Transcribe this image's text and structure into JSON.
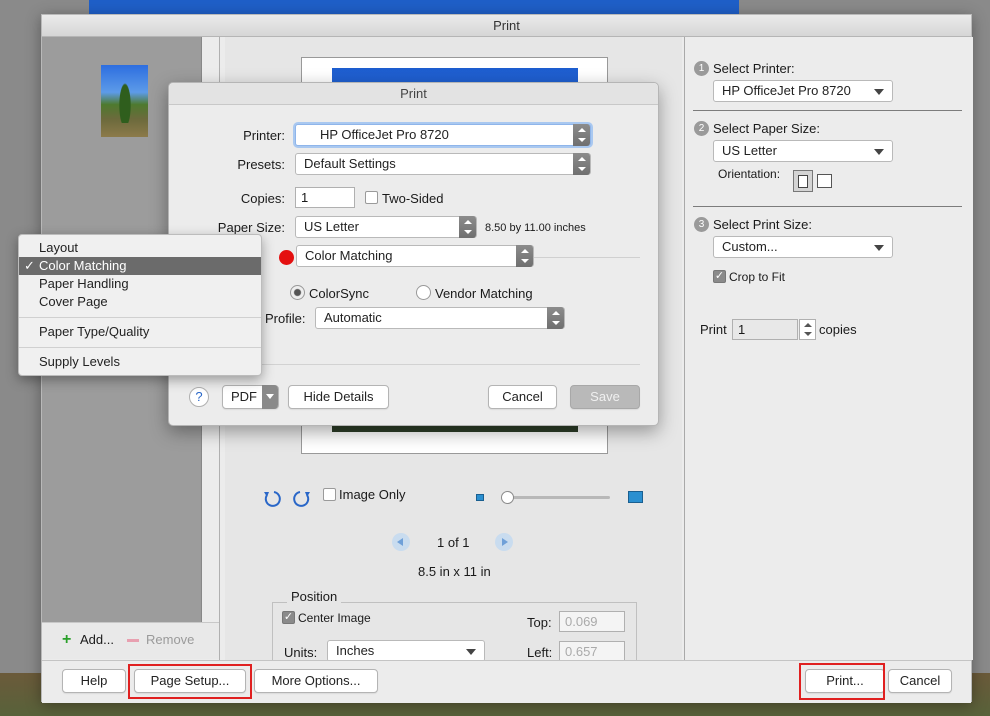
{
  "window": {
    "title": "Print"
  },
  "left_panel": {
    "add_label": "Add...",
    "remove_label": "Remove"
  },
  "preview": {
    "image_only_label": "Image Only",
    "page_indicator": "1 of 1",
    "paper_dims": "8.5 in x 11 in",
    "position": {
      "group_label": "Position",
      "center_image_label": "Center Image",
      "units_label": "Units:",
      "units_value": "Inches",
      "top_label": "Top:",
      "top_value": "0.069",
      "left_label": "Left:",
      "left_value": "0.657"
    }
  },
  "right_panel": {
    "step1_num": "1",
    "step1_label": "Select Printer:",
    "printer_value": "HP OfficeJet Pro 8720",
    "step2_num": "2",
    "step2_label": "Select Paper Size:",
    "paper_value": "US Letter",
    "orientation_label": "Orientation:",
    "step3_num": "3",
    "step3_label": "Select Print Size:",
    "print_size_value": "Custom...",
    "crop_label": "Crop to Fit",
    "print_label": "Print",
    "copies_value": "1",
    "copies_label": "copies"
  },
  "bottom_bar": {
    "help": "Help",
    "page_setup": "Page Setup...",
    "more_options": "More Options...",
    "print": "Print...",
    "cancel": "Cancel"
  },
  "dialog": {
    "title": "Print",
    "printer_label": "Printer:",
    "printer_value": "HP OfficeJet Pro 8720",
    "presets_label": "Presets:",
    "presets_value": "Default Settings",
    "copies_label": "Copies:",
    "copies_value": "1",
    "two_sided_label": "Two-Sided",
    "paper_size_label": "Paper Size:",
    "paper_size_value": "US Letter",
    "paper_size_dims": "8.50 by 11.00 inches",
    "section_value": "Color Matching",
    "colorsync_label": "ColorSync",
    "vendor_matching_label": "Vendor Matching",
    "profile_label": "Profile:",
    "profile_value": "Automatic",
    "help_glyph": "?",
    "pdf_label": "PDF",
    "hide_details": "Hide Details",
    "cancel": "Cancel",
    "save": "Save"
  },
  "section_menu": {
    "check_glyph": "✓",
    "items": [
      "Layout",
      "Color Matching",
      "Paper Handling",
      "Cover Page",
      "Paper Type/Quality",
      "Supply Levels"
    ],
    "selected": "Color Matching"
  },
  "colors": {
    "highlight": "#e02020",
    "red_dot": "#e41010",
    "menu_selected": "#6b6b6b"
  }
}
